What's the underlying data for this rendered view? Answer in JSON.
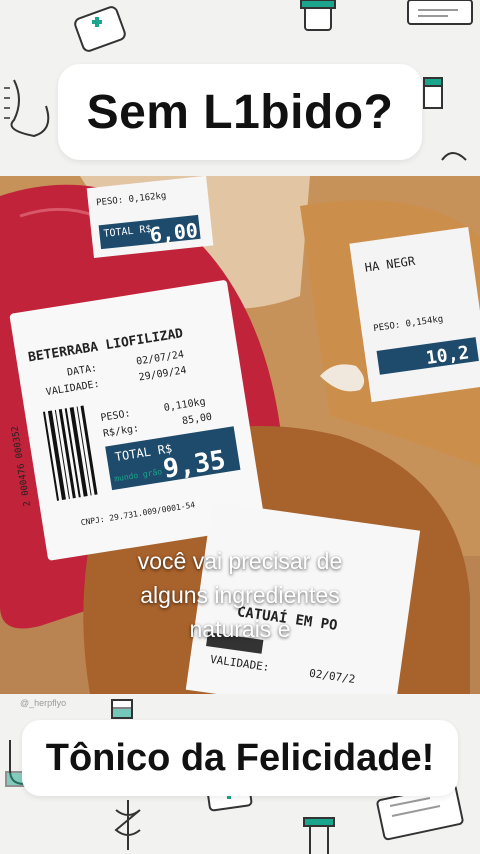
{
  "header": {
    "title": "Sem L1bido?"
  },
  "caption": {
    "lines": [
      "você vai precisar de",
      "alguns ingredientes",
      "naturais e"
    ]
  },
  "footer": {
    "title": "Tônico da Felicidade!",
    "watermark": "@_herpflyo"
  },
  "labels": {
    "beet": {
      "name": "BETERRABA LIOFILIZAD",
      "data": "DATA:",
      "data_val": "02/07/24",
      "validade": "VALIDADE:",
      "validade_val": "29/09/24",
      "peso": "PESO:",
      "peso_val": "0,110kg",
      "rs_kg": "R$/kg:",
      "rs_kg_val": "85,00",
      "total": "TOTAL R$",
      "total_val": "9,35",
      "barcode": "2 000476 000352",
      "cnpj": "CNPJ: 29.731.009/0001-54",
      "brand": "mundo grão"
    },
    "top": {
      "total": "TOTAL R$",
      "total_val": "6,00",
      "peso": "PESO: 0,162kg"
    },
    "right": {
      "name": "HA NEGR",
      "peso": "PESO: 0,154kg",
      "total_val": "10,2"
    },
    "bottom": {
      "name": "CATUAÍ EM PO",
      "validade": "VALIDADE:",
      "data_val": "02/07/2"
    }
  },
  "colors": {
    "accent": "#1aa58c",
    "pill_bg": "#ffffff",
    "beet_red": "#c0233a"
  }
}
